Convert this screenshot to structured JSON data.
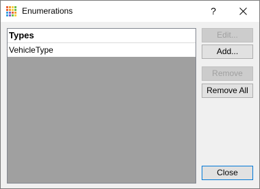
{
  "window": {
    "title": "Enumerations",
    "help_label": "?"
  },
  "list": {
    "header": "Types",
    "items": [
      "VehicleType"
    ]
  },
  "buttons": {
    "edit": "Edit...",
    "add": "Add...",
    "remove": "Remove",
    "remove_all": "Remove All",
    "close": "Close"
  },
  "icon_colors": [
    "#e8623a",
    "#f0a030",
    "#f5d040",
    "#6cbf4a",
    "#e8623a",
    "#f0a030",
    "#f5d040",
    "#6cbf4a",
    "#3aa0e0",
    "#7a5cc8",
    "#e8623a",
    "#f0a030",
    "#3aa0e0",
    "#7a5cc8",
    "#6cbf4a",
    "#f5d040"
  ]
}
